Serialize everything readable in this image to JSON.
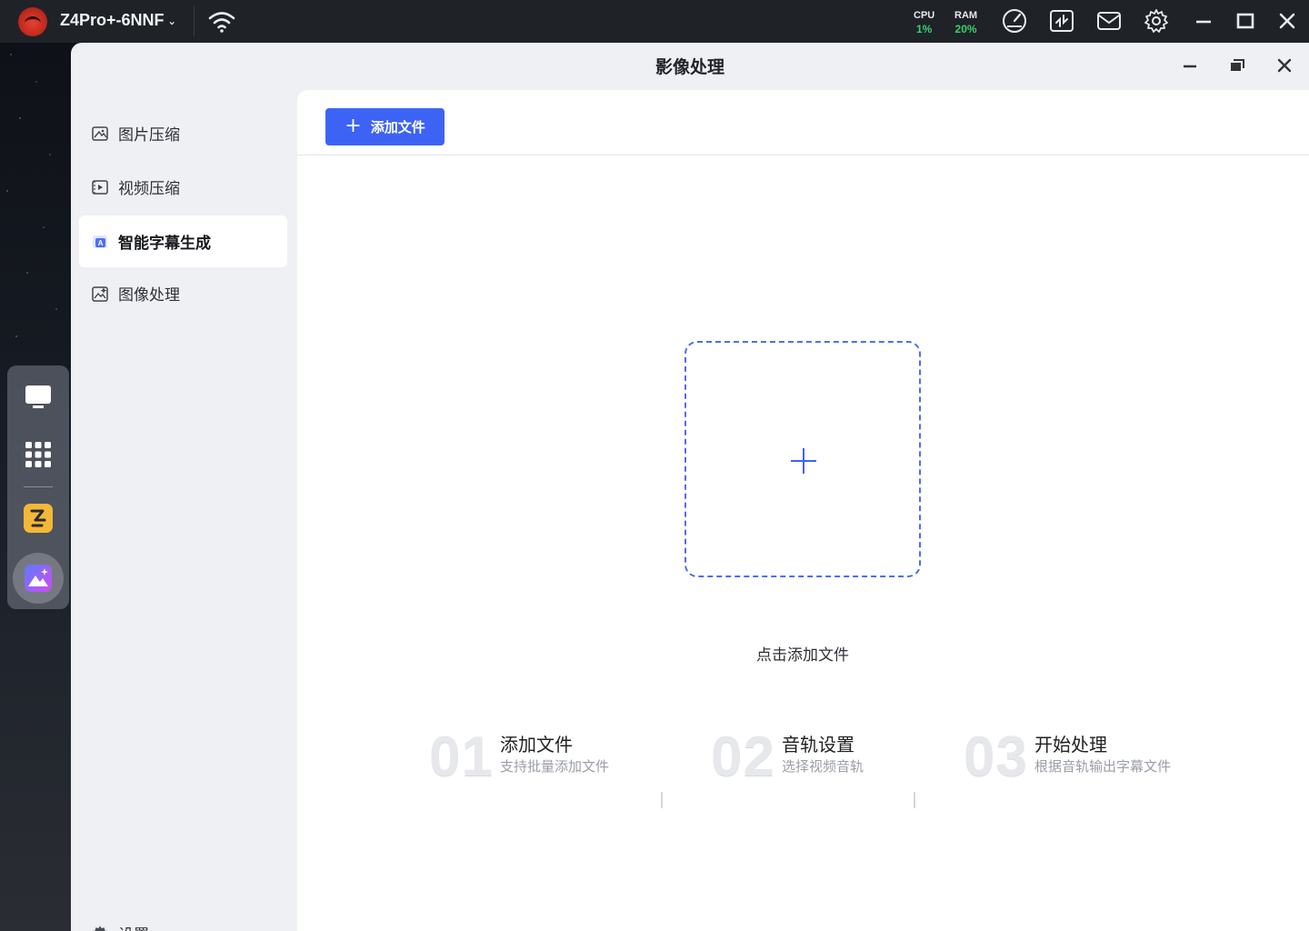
{
  "system_bar": {
    "device_name": "Z4Pro+-6NNF",
    "cpu_label": "CPU",
    "cpu_value": "1%",
    "ram_label": "RAM",
    "ram_value": "20%",
    "stat_color": "#36d36b"
  },
  "window": {
    "title": "影像处理"
  },
  "sidebar": {
    "items": [
      {
        "label": "图片压缩",
        "icon": "image-compress-icon"
      },
      {
        "label": "视频压缩",
        "icon": "video-compress-icon"
      },
      {
        "label": "智能字幕生成",
        "icon": "subtitle-icon",
        "active": true
      },
      {
        "label": "图像处理",
        "icon": "image-edit-icon"
      }
    ],
    "settings_label": "设置"
  },
  "main": {
    "add_button_label": "添加文件",
    "drop_label": "点击添加文件",
    "accent_color": "#3d63f5",
    "steps": [
      {
        "num": "01",
        "title": "添加文件",
        "desc": "支持批量添加文件"
      },
      {
        "num": "02",
        "title": "音轨设置",
        "desc": "选择视频音轨"
      },
      {
        "num": "03",
        "title": "开始处理",
        "desc": "根据音轨输出字幕文件"
      }
    ]
  }
}
